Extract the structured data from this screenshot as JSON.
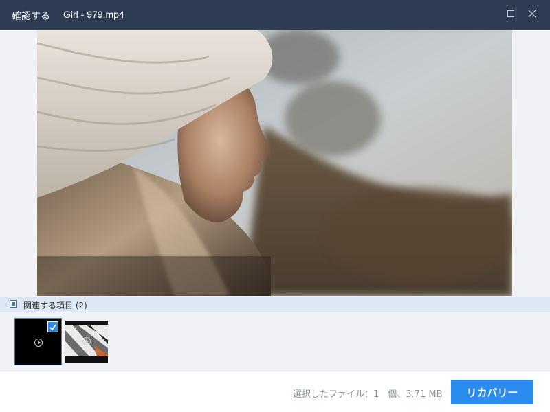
{
  "window": {
    "title": "確認する",
    "file_name": "Girl - 979.mp4",
    "icons": {
      "maximize": "maximize-icon",
      "close": "close-icon"
    }
  },
  "related": {
    "label": "関連する項目 (2)",
    "items": [
      {
        "kind": "video",
        "selected": true
      },
      {
        "kind": "video",
        "selected": false
      }
    ]
  },
  "footer": {
    "status": "選択したファイル：1　個、3.71 MB",
    "recover_label": "リカバリー"
  },
  "colors": {
    "titlebar": "#2f3d54",
    "accent": "#2b8cf0",
    "related_bar": "#dde8f6"
  }
}
